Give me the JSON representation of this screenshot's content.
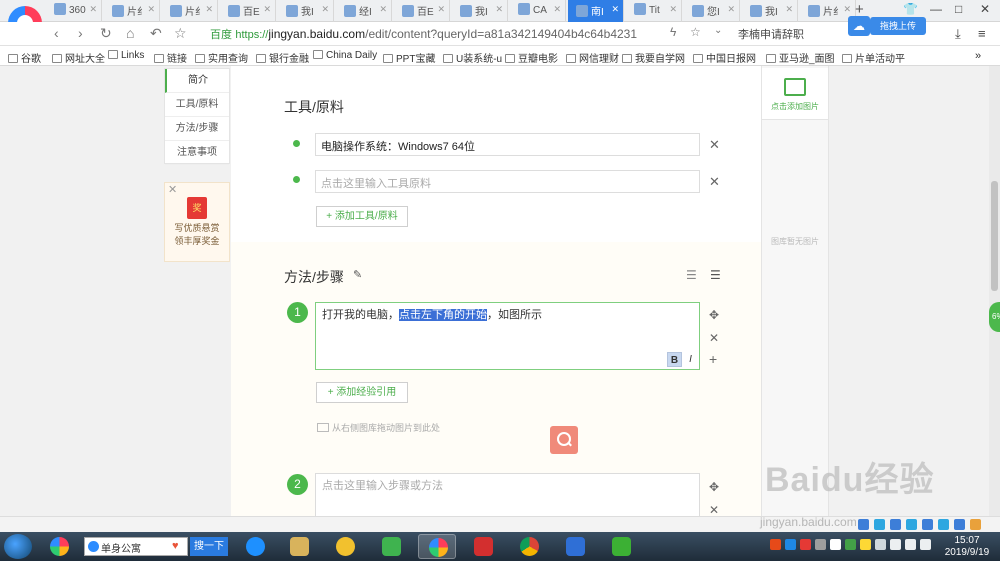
{
  "browser": {
    "tabs": [
      {
        "label": "360",
        "active": false
      },
      {
        "label": "片纟",
        "active": false
      },
      {
        "label": "片纟",
        "active": false
      },
      {
        "label": "百E",
        "active": false
      },
      {
        "label": "我I",
        "active": false
      },
      {
        "label": "经I",
        "active": false
      },
      {
        "label": "百E",
        "active": false
      },
      {
        "label": "我I",
        "active": false
      },
      {
        "label": "CA",
        "active": false
      },
      {
        "label": "南I",
        "active": true
      },
      {
        "label": "Tit",
        "active": false
      },
      {
        "label": "您I",
        "active": false
      },
      {
        "label": "我I",
        "active": false
      },
      {
        "label": "片纟",
        "active": false
      }
    ],
    "new_tab": "+",
    "site_badge": "百度",
    "url_scheme": "https://",
    "url_host": "jingyan.baidu.com",
    "url_rest": "/edit/content?queryId=a81a342149404b4c64b4231",
    "search_suggest": "李楠申请辞职",
    "upload_label": "拖拽上传",
    "window_controls": [
      "—",
      "□",
      "✕"
    ]
  },
  "bookmarks": [
    {
      "label": "谷歌"
    },
    {
      "label": "网址大全"
    },
    {
      "label": "Links"
    },
    {
      "label": "链接"
    },
    {
      "label": "实用查询"
    },
    {
      "label": "银行金融"
    },
    {
      "label": "China Daily"
    },
    {
      "label": "PPT宝藏"
    },
    {
      "label": "U装系统-u"
    },
    {
      "label": "豆瓣电影"
    },
    {
      "label": "网信理财"
    },
    {
      "label": "我要自学网"
    },
    {
      "label": "中国日报网"
    },
    {
      "label": "亚马逊_面图"
    },
    {
      "label": "片单活动平"
    }
  ],
  "bookmarks_more": "»",
  "outline": {
    "items": [
      {
        "label": "简介",
        "active": true
      },
      {
        "label": "工具/原料",
        "active": false
      },
      {
        "label": "方法/步骤",
        "active": false
      },
      {
        "label": "注意事项",
        "active": false
      }
    ]
  },
  "promo": {
    "close": "✕",
    "gift": "奖",
    "line1": "写优质悬赏",
    "line2": "领丰厚奖金"
  },
  "tools": {
    "title": "工具/原料",
    "items": [
      {
        "value": "电脑操作系统：Windows7 64位",
        "placeholder": ""
      },
      {
        "value": "",
        "placeholder": "点击这里输入工具原料"
      }
    ],
    "remove_icon": "✕",
    "add_button": "+ 添加工具/原料"
  },
  "steps": {
    "title": "方法/步骤",
    "items": [
      {
        "num": "1",
        "pre": "打开我的电脑，",
        "highlight": "点击左下角的开始",
        "post": "，如图所示"
      },
      {
        "num": "2",
        "placeholder": "点击这里输入步骤或方法"
      }
    ],
    "bold_label": "B",
    "italic_label": "I",
    "move_icon": "✥",
    "remove_icon": "✕",
    "add_icon": "+",
    "add_ref_button": "+ 添加经验引用",
    "drag_hint": "从右侧图库拖动图片到此处"
  },
  "gallery": {
    "add_label": "点击添加图片",
    "empty_label": "图库暂无图片"
  },
  "watermark": {
    "brand": "Baidu经验",
    "url": "jingyan.baidu.com"
  },
  "taskbar": {
    "search_text": "单身公寓",
    "search_button": "搜一下",
    "time": "15:07",
    "date": "2019/9/19"
  },
  "colors": {
    "accent_green": "#4cb84c",
    "selection_blue": "#3b6fd6",
    "tab_active": "#2f7ee6"
  }
}
